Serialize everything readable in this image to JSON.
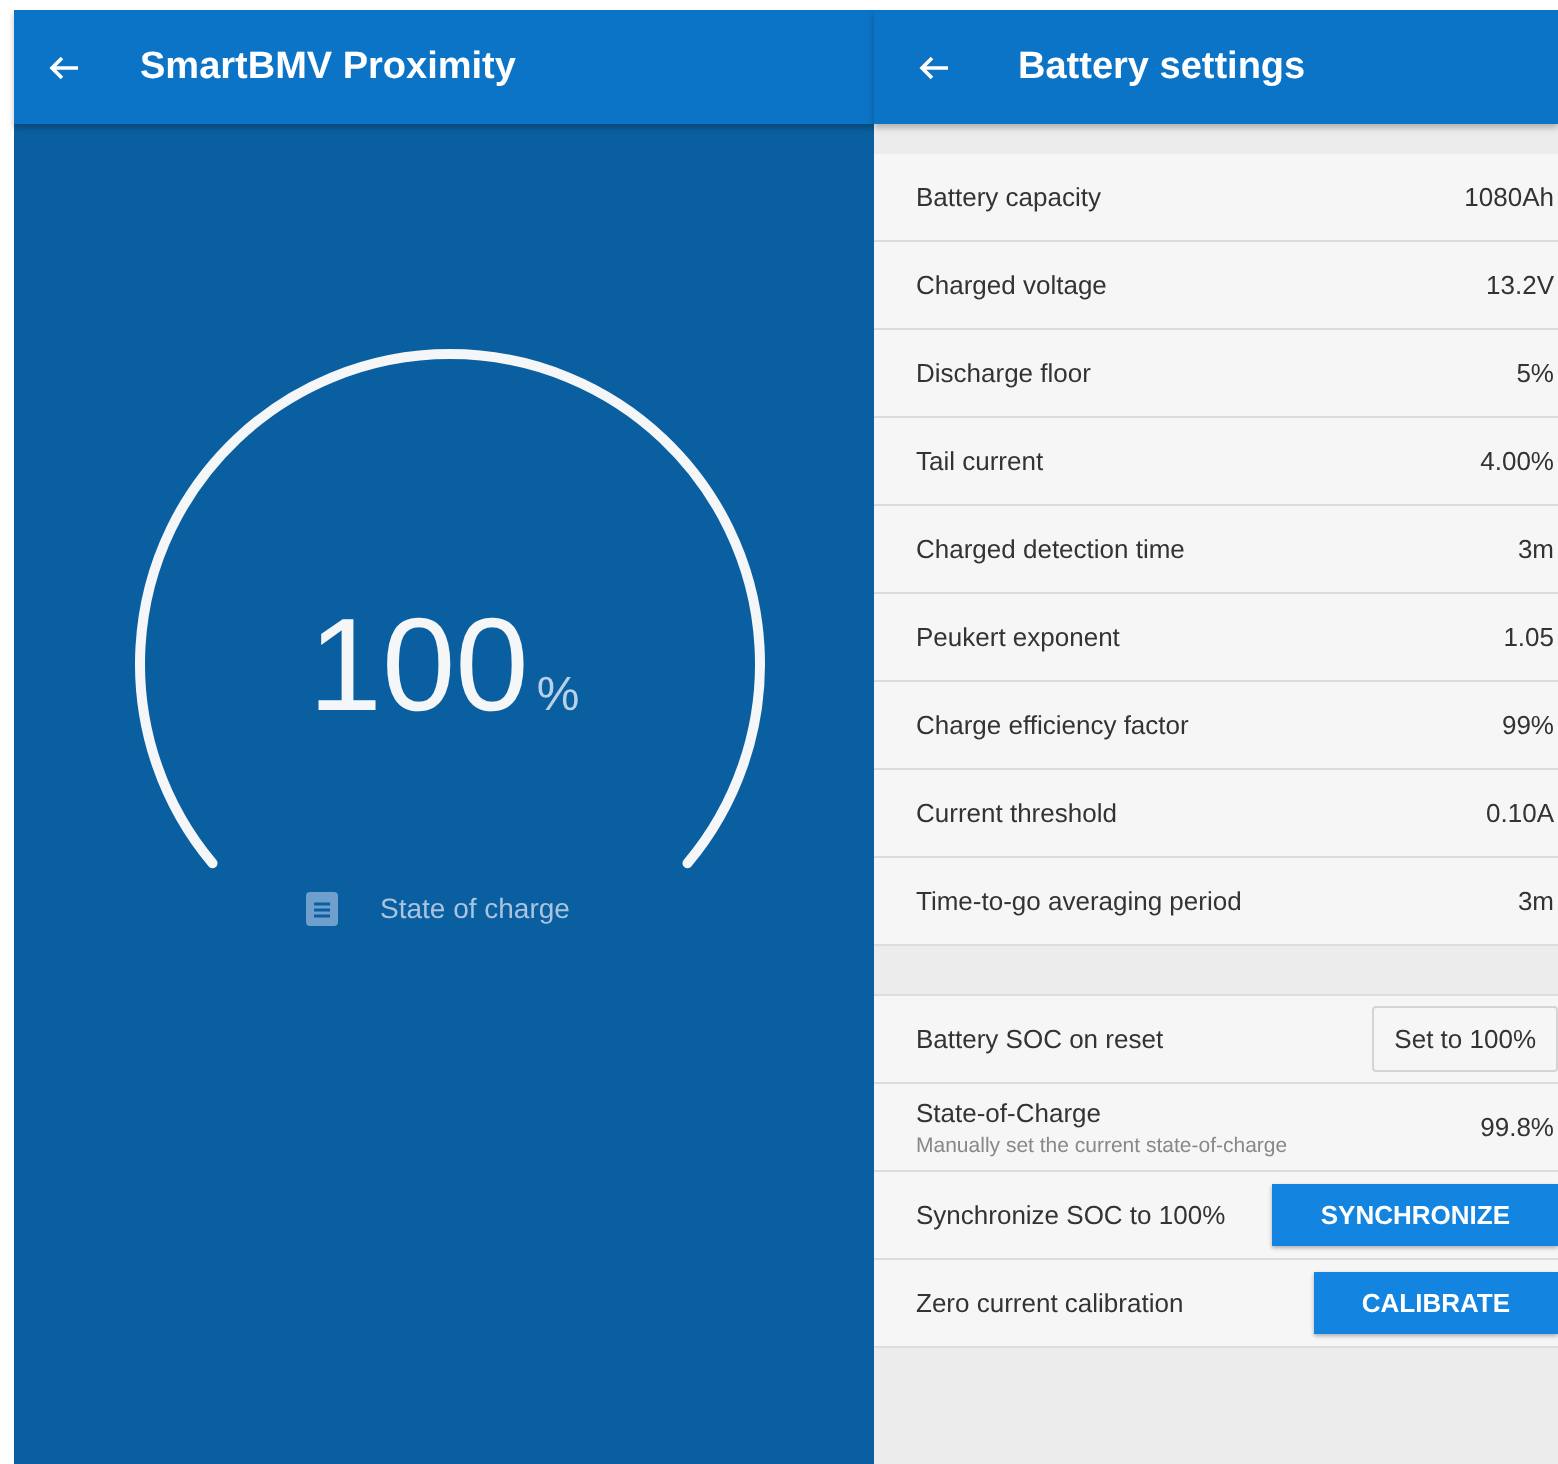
{
  "left_panel": {
    "title": "SmartBMV Proximity",
    "gauge": {
      "value": "100",
      "unit": "%",
      "label": "State of charge"
    }
  },
  "right_panel": {
    "title": "Battery settings",
    "settings": [
      {
        "kind": "value",
        "label": "Battery capacity",
        "value": "1080Ah"
      },
      {
        "kind": "value",
        "label": "Charged voltage",
        "value": "13.2V"
      },
      {
        "kind": "value",
        "label": "Discharge floor",
        "value": "5%"
      },
      {
        "kind": "value",
        "label": "Tail current",
        "value": "4.00%"
      },
      {
        "kind": "value",
        "label": "Charged detection time",
        "value": "3m"
      },
      {
        "kind": "value",
        "label": "Peukert exponent",
        "value": "1.05"
      },
      {
        "kind": "value",
        "label": "Charge efficiency factor",
        "value": "99%"
      },
      {
        "kind": "value",
        "label": "Current threshold",
        "value": "0.10A"
      },
      {
        "kind": "value",
        "label": "Time-to-go averaging period",
        "value": "3m"
      }
    ],
    "actions": [
      {
        "kind": "option",
        "label": "Battery SOC on reset",
        "value": "Set to 100%"
      },
      {
        "kind": "value",
        "label": "State-of-Charge",
        "subtitle": "Manually set the current state-of-charge",
        "value": "99.8%"
      },
      {
        "kind": "action",
        "label": "Synchronize SOC to 100%",
        "value": "SYNCHRONIZE"
      },
      {
        "kind": "action",
        "label": "Zero current calibration",
        "value": "CALIBRATE"
      }
    ]
  }
}
